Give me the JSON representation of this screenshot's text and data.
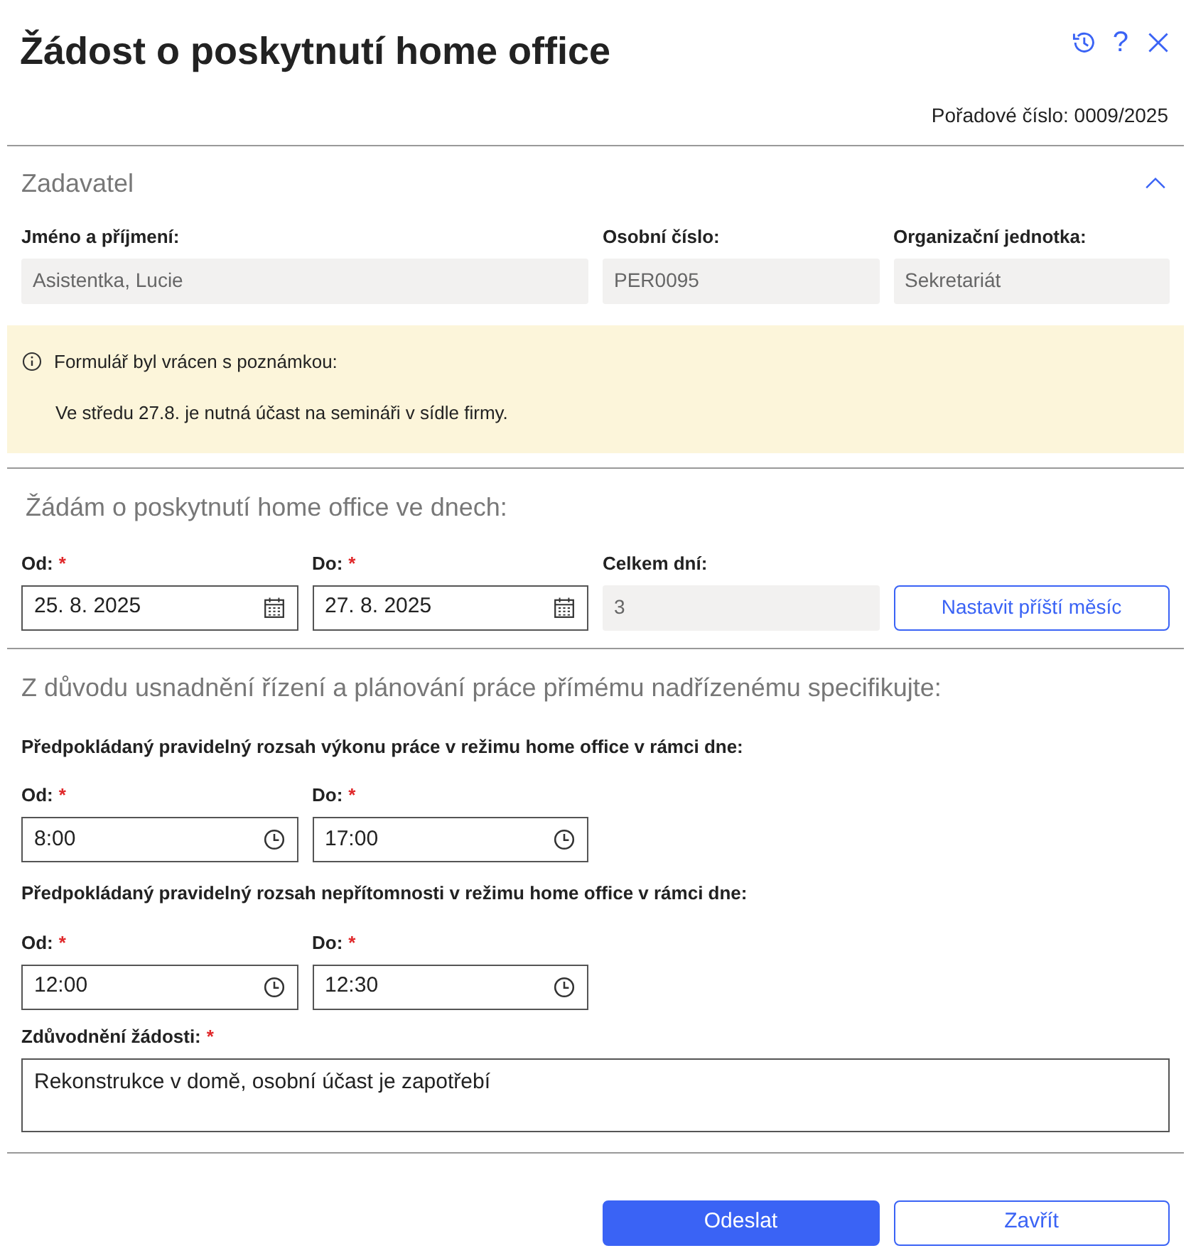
{
  "title": "Žádost o poskytnutí home office",
  "header_icons": [
    {
      "kind": "history"
    },
    {
      "kind": "help",
      "symbol": "?"
    },
    {
      "kind": "close"
    }
  ],
  "serial_number": "Pořadové číslo: 0009/2025",
  "applicant": {
    "heading": "Zadavatel",
    "expanded": true,
    "fields": [
      {
        "label": "Jméno a příjmení:",
        "value": "Asistentka, Lucie"
      },
      {
        "label": "Osobní číslo:",
        "value": "PER0095"
      },
      {
        "label": "Organizační jednotka:",
        "value": "Sekretariát"
      }
    ]
  },
  "notice": {
    "title": "Formulář byl vrácen s poznámkou:",
    "text": "Ve středu 27.8. je nutná účast na semináři v sídle firmy."
  },
  "dates": {
    "heading": "Žádám o poskytnutí home office ve dnech:",
    "fields": [
      {
        "kind": "date",
        "label": "Od:",
        "required_mark": "*",
        "value": "25. 8. 2025"
      },
      {
        "kind": "date",
        "label": "Do:",
        "required_mark": "*",
        "value": "27. 8. 2025"
      },
      {
        "kind": "readonly",
        "label": "Celkem dní:",
        "value": "3"
      },
      {
        "kind": "button",
        "label": "Nastavit příští měsíc"
      }
    ]
  },
  "schedule": {
    "heading": "Z důvodu usnadnění řízení a plánování práce přímému nadřízenému specifikujte:",
    "groups": [
      {
        "title": "Předpokládaný pravidelný rozsah výkonu práce v režimu home office v rámci dne:",
        "fields": [
          {
            "kind": "time",
            "label": "Od:",
            "required_mark": "*",
            "value": "8:00"
          },
          {
            "kind": "time",
            "label": "Do:",
            "required_mark": "*",
            "value": "17:00"
          }
        ]
      },
      {
        "title": "Předpokládaný pravidelný rozsah nepřítomnosti v režimu home office v rámci dne:",
        "fields": [
          {
            "kind": "time",
            "label": "Od:",
            "required_mark": "*",
            "value": "12:00"
          },
          {
            "kind": "time",
            "label": "Do:",
            "required_mark": "*",
            "value": "12:30"
          }
        ]
      }
    ],
    "reason": {
      "label": "Zdůvodnění žádosti:",
      "required_mark": "*",
      "value": "Rekonstrukce v domě, osobní účast je zapotřebí"
    }
  },
  "buttons": [
    {
      "kind": "primary",
      "label": "Odeslat"
    },
    {
      "kind": "secondary",
      "label": "Zavřít"
    }
  ]
}
